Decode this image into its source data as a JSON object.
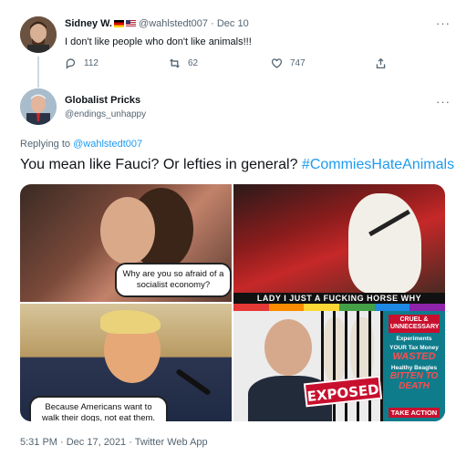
{
  "top_tweet": {
    "author_name": "Sidney W.",
    "handle": "@wahlstedt007",
    "separator": "·",
    "date": "Dec 10",
    "text": "I don't like people who don't like animals!!!",
    "actions": {
      "reply_count": "112",
      "retweet_count": "62",
      "like_count": "747"
    }
  },
  "reply_tweet": {
    "author_name": "Globalist Pricks",
    "handle": "@endings_unhappy",
    "replying_prefix": "Replying to",
    "replying_to": "@wahlstedt007",
    "text": "You mean like Fauci?  Or lefties in general?",
    "hashtag": "#CommiesHateAnimals",
    "timestamp": "5:31 PM · Dec 17, 2021 · Twitter Web App"
  },
  "media": {
    "panel1_bubble": "Why are you so afraid of a socialist economy?",
    "panel2_caption": "LADY I JUST A FUCKING HORSE WHY",
    "panel3_bubble": "Because Americans want to walk their dogs, not eat them.",
    "panel4": {
      "stamp": "EXPOSED",
      "badge": "CRUEL & UNNECESSARY",
      "experiments": "Experiments",
      "tax": "YOUR Tax Money",
      "wasted": "WASTED",
      "beagles": "Healthy Beagles",
      "bitten": "BITTEN TO DEATH",
      "action": "TAKE ACTION"
    }
  },
  "colors": {
    "link": "#1d9bf0",
    "muted": "#536471",
    "text": "#0f1419"
  }
}
